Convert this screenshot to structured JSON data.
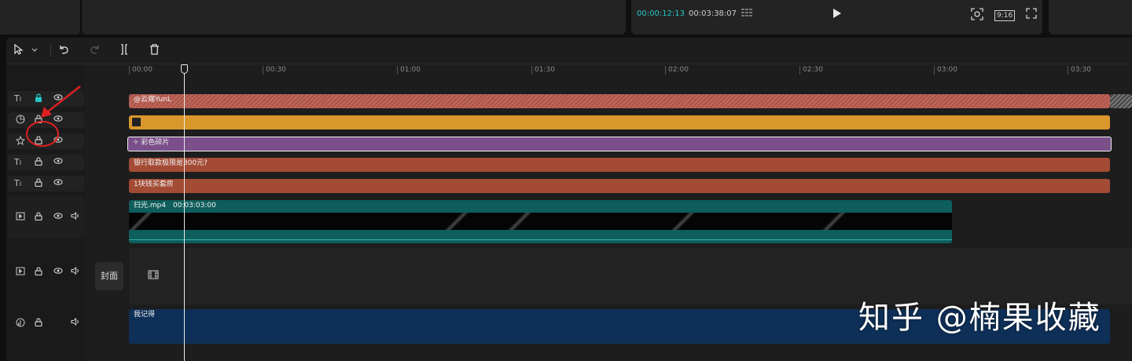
{
  "player": {
    "current_time": "00:00:12:13",
    "total_time": "00:03:38:07",
    "list_icon": "list-icon",
    "play_icon": "play-icon",
    "fit_icon": "focus-icon",
    "ratio_label": "9:16",
    "fullscreen_icon": "fullscreen-icon"
  },
  "toolbar": {
    "select_icon": "cursor-arrow-icon",
    "dropdown_icon": "chevron-down-icon",
    "undo_icon": "undo-icon",
    "redo_icon": "redo-icon",
    "split_icon": "split-icon",
    "delete_icon": "trash-icon"
  },
  "ruler": {
    "ticks": [
      "00:00",
      "00:30",
      "01:00",
      "01:30",
      "02:00",
      "02:30",
      "03:00",
      "03:30"
    ]
  },
  "tracks": {
    "title_clip": "@云端YunL",
    "effect_clip": "彩色碎片",
    "text_clip_1": "银行取款极限是300元?",
    "text_clip_2": "1块钱买套房",
    "video_clip_name": "扫光.mp4",
    "video_clip_duration": "00:03:03:00",
    "audio_clip": "我记得"
  },
  "cover": {
    "label": "封面"
  },
  "watermark": {
    "text": "知乎 @楠果收藏"
  },
  "colors": {
    "accent_teal": "#26c6c6",
    "annotation_red": "#e02020",
    "clip_orange": "#d9972c",
    "clip_purple": "#7b4f8a",
    "clip_red": "#a44b35",
    "clip_video": "#0d5e5c",
    "clip_audio": "#0e2f57"
  }
}
